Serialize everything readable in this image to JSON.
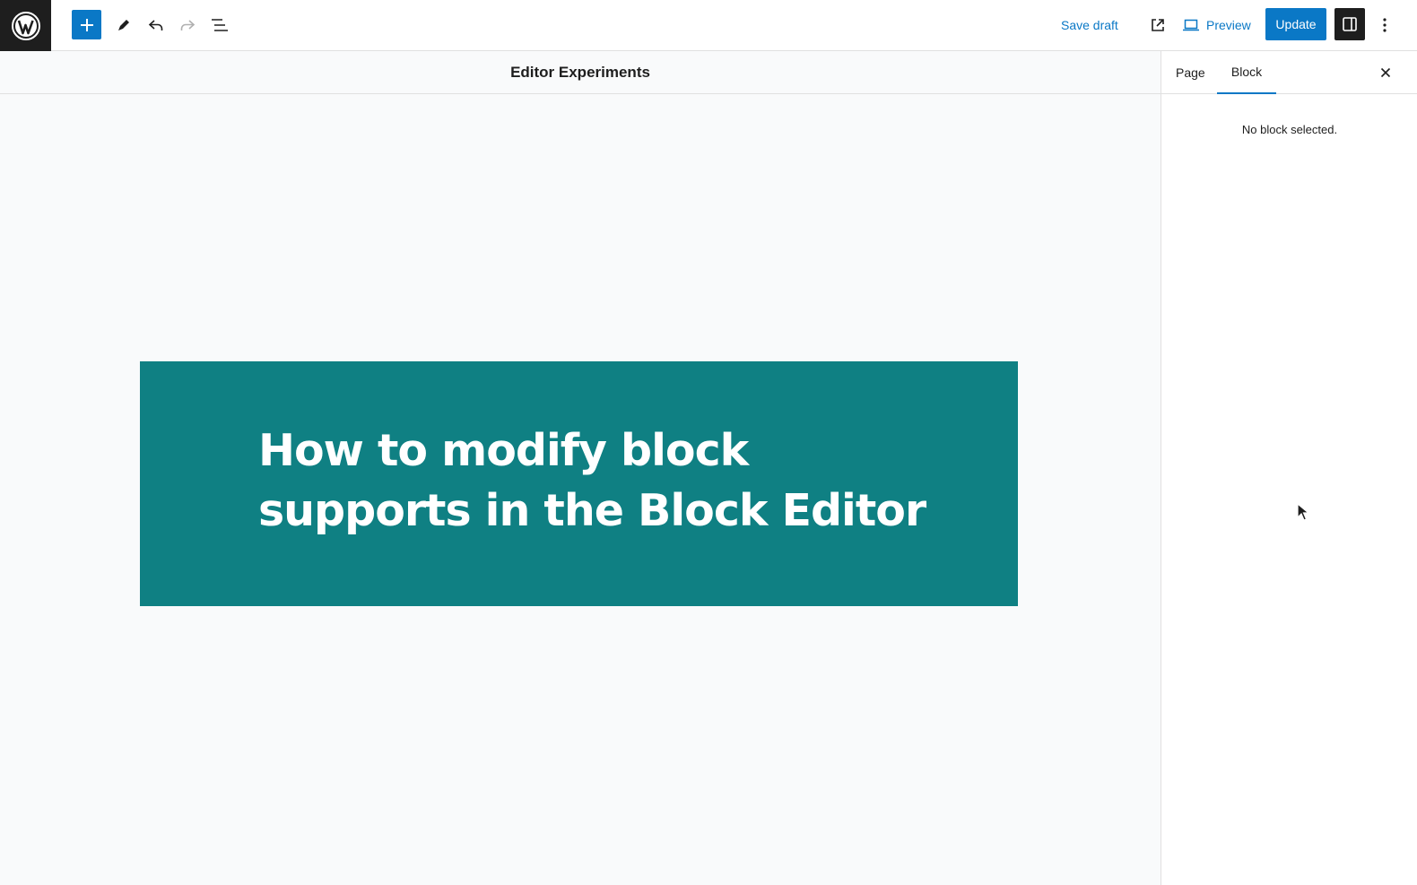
{
  "toolbar": {
    "save_draft_label": "Save draft",
    "preview_label": "Preview",
    "update_label": "Update",
    "icons": [
      "wordpress-logo-icon",
      "plus-icon",
      "pencil-icon",
      "undo-icon",
      "redo-icon",
      "list-view-icon",
      "external-link-icon",
      "laptop-icon",
      "sidebar-icon",
      "more-vertical-icon"
    ]
  },
  "document": {
    "title": "Editor Experiments"
  },
  "cover": {
    "heading_line1": "How to modify block",
    "heading_line2": "supports in the Block Editor",
    "background_color": "#0f8083"
  },
  "sidebar": {
    "tabs": [
      {
        "label": "Page",
        "active": false
      },
      {
        "label": "Block",
        "active": true
      }
    ],
    "empty_message": "No block selected."
  },
  "colors": {
    "accent": "#0a78c6",
    "dark": "#1e1e1e"
  }
}
